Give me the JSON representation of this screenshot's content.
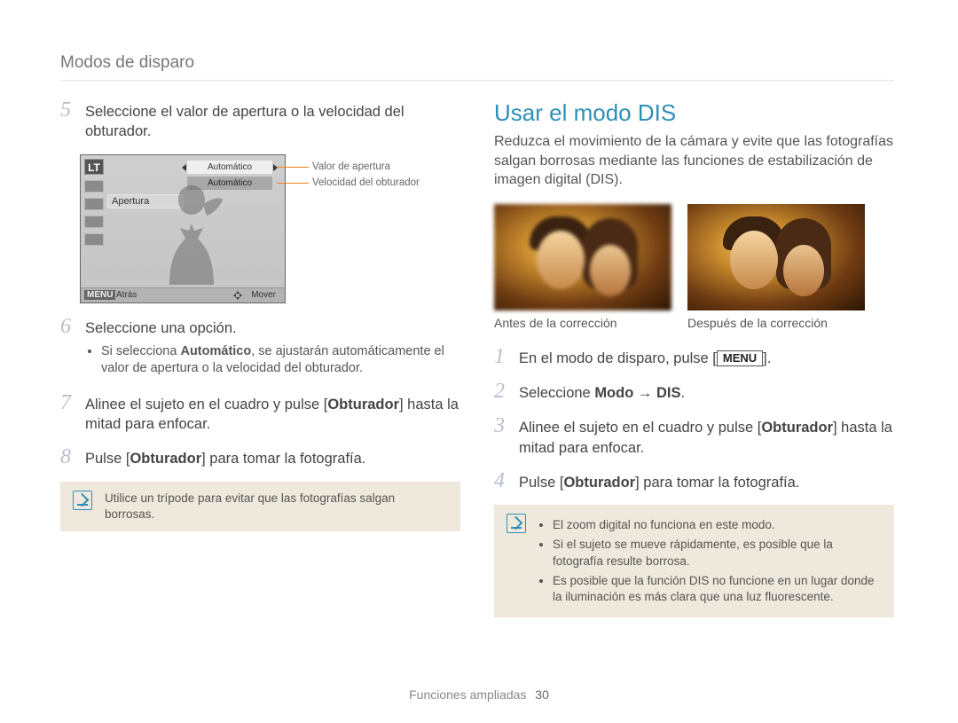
{
  "header": {
    "title": "Modos de disparo"
  },
  "left": {
    "step5": {
      "num": "5",
      "text_pre": "Seleccione el valor de apertura o la velocidad del obturador."
    },
    "lcd": {
      "mode": "LT",
      "row1": "Automático",
      "row2": "Automático",
      "apertura": "Apertura",
      "menu": "MENU",
      "atras": "Atrás",
      "mover": "Mover"
    },
    "callout1": "Valor de apertura",
    "callout2": "Velocidad del obturador",
    "step6": {
      "num": "6",
      "text": "Seleccione una opción.",
      "bullet_pre": "Si selecciona ",
      "bullet_bold": "Automático",
      "bullet_post": ", se ajustarán automáticamente el valor de apertura o la velocidad del obturador."
    },
    "step7": {
      "num": "7",
      "pre": "Alinee el sujeto en el cuadro y pulse [",
      "bold": "Obturador",
      "post": "] hasta la mitad para enfocar."
    },
    "step8": {
      "num": "8",
      "pre": "Pulse [",
      "bold": "Obturador",
      "post": "] para tomar la fotografía."
    },
    "tip": "Utilice un trípode para evitar que las fotografías salgan borrosas."
  },
  "right": {
    "heading": "Usar el modo DIS",
    "intro": "Reduzca el movimiento de la cámara y evite que las fotografías salgan borrosas mediante las funciones de estabilización de imagen digital (DIS).",
    "cap_before": "Antes de la corrección",
    "cap_after": "Después de la corrección",
    "step1": {
      "num": "1",
      "pre": "En el modo de disparo, pulse [",
      "kbd": "MENU",
      "post": "]."
    },
    "step2": {
      "num": "2",
      "pre": "Seleccione ",
      "bold": "Modo → DIS",
      "post": "."
    },
    "step3": {
      "num": "3",
      "pre": "Alinee el sujeto en el cuadro y pulse [",
      "bold": "Obturador",
      "post": "] hasta la mitad para enfocar."
    },
    "step4": {
      "num": "4",
      "pre": "Pulse [",
      "bold": "Obturador",
      "post": "] para tomar la fotografía."
    },
    "tip": [
      "El zoom digital no funciona en este modo.",
      "Si el sujeto se mueve rápidamente, es posible que la fotografía resulte borrosa.",
      "Es posible que la función DIS no funcione en un lugar donde la iluminación es más clara que una luz fluorescente."
    ]
  },
  "footer": {
    "section": "Funciones ampliadas",
    "page": "30"
  }
}
